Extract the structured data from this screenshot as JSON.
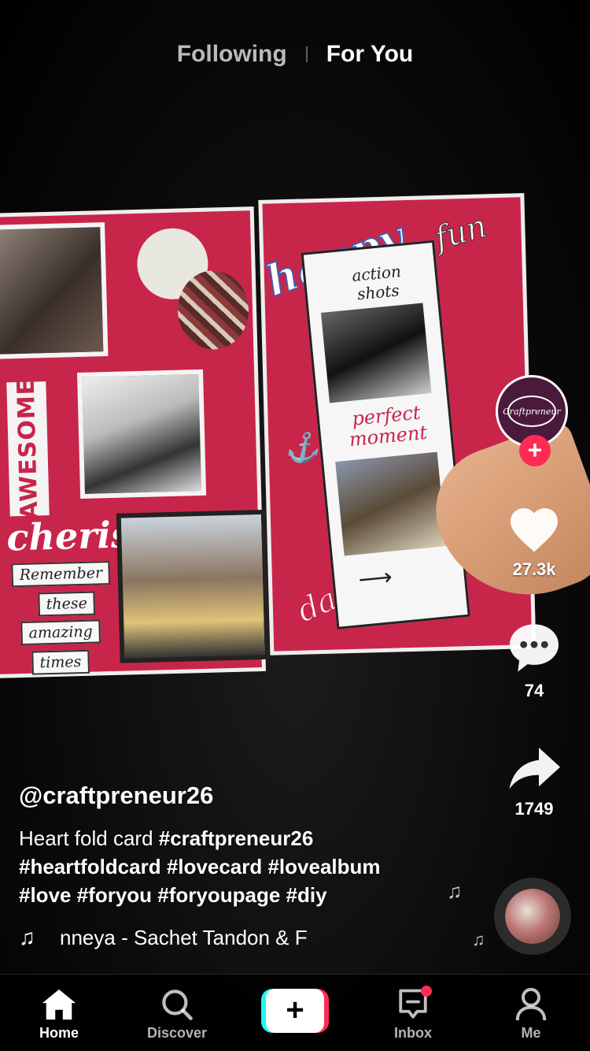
{
  "top_tabs": {
    "following": "Following",
    "for_you": "For You",
    "active": "For You"
  },
  "creator": {
    "avatar_text": "Craftpreneur",
    "follow_symbol": "+"
  },
  "actions": {
    "likes": "27.3k",
    "comments": "74",
    "shares": "1749"
  },
  "post": {
    "username": "@craftpreneur26",
    "caption_text": "Heart fold card",
    "hashtags_line1": "#craftpreneur26",
    "hashtags_line2": "#heartfoldcard #lovecard #lovealbum",
    "hashtags_line3": "#love #foryou #foryoupage #diy",
    "sound": "nneya - Sachet Tandon & F"
  },
  "video_text": {
    "happy": "happy",
    "fun": "fun",
    "action_shots": "action shots",
    "perfect_moment": "perfect moment",
    "days": "days",
    "awesome": "AWESOME",
    "cherish": "cherish",
    "remember": [
      "Remember",
      "these",
      "amazing",
      "times"
    ]
  },
  "bottom_nav": {
    "home": "Home",
    "discover": "Discover",
    "create": "+",
    "inbox": "Inbox",
    "me": "Me"
  },
  "colors": {
    "accent_red": "#fe2c55",
    "accent_cyan": "#25f4ee",
    "card_red": "#c8254a"
  }
}
